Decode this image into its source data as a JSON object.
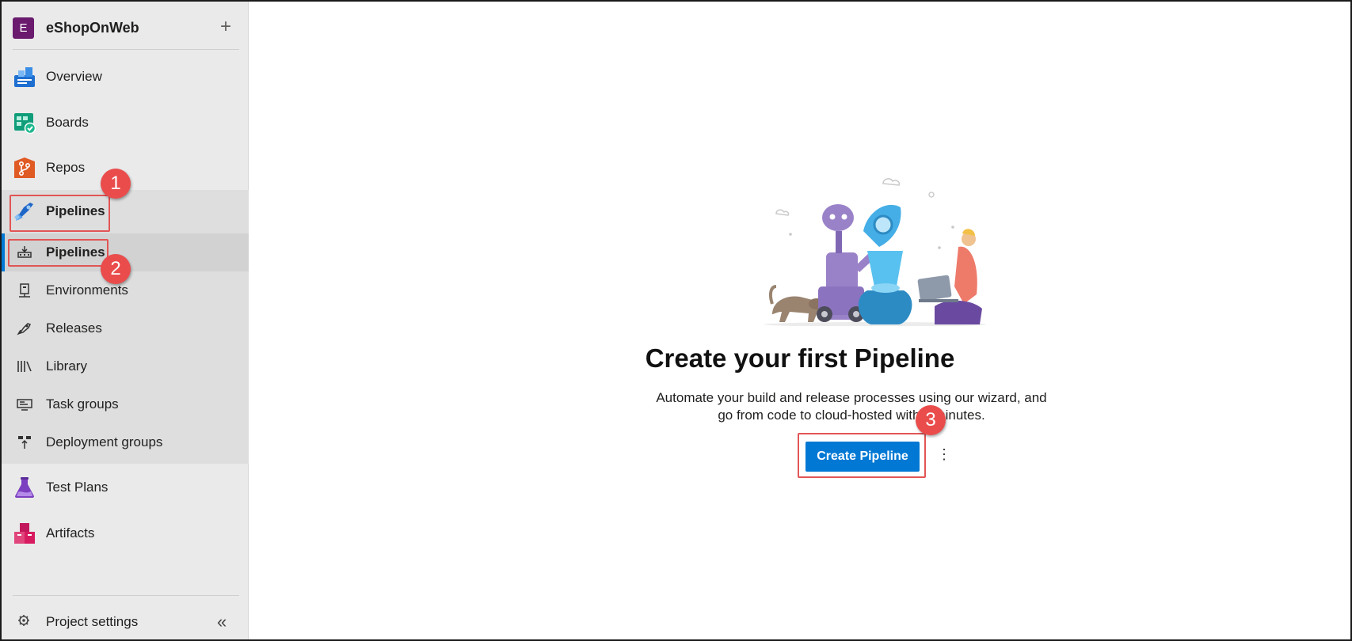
{
  "project": {
    "avatar_letter": "E",
    "name": "eShopOnWeb",
    "add_symbol": "+"
  },
  "nav": {
    "overview": "Overview",
    "boards": "Boards",
    "repos": "Repos",
    "pipelines": "Pipelines",
    "test_plans": "Test Plans",
    "artifacts": "Artifacts"
  },
  "pipelines_sub": {
    "pipelines": "Pipelines",
    "environments": "Environments",
    "releases": "Releases",
    "library": "Library",
    "task_groups": "Task groups",
    "deployment_groups": "Deployment groups"
  },
  "footer": {
    "project_settings": "Project settings",
    "collapse": "«"
  },
  "main": {
    "title": "Create your first Pipeline",
    "description": "Automate your build and release processes using our wizard, and go from code to cloud-hosted within minutes.",
    "create_button": "Create Pipeline",
    "more_symbol": "⋮"
  },
  "annotations": {
    "step1": "1",
    "step2": "2",
    "step3": "3"
  },
  "colors": {
    "accent": "#0078d4",
    "annotation_red": "#ea4c4c",
    "avatar": "#6a1b6e"
  }
}
